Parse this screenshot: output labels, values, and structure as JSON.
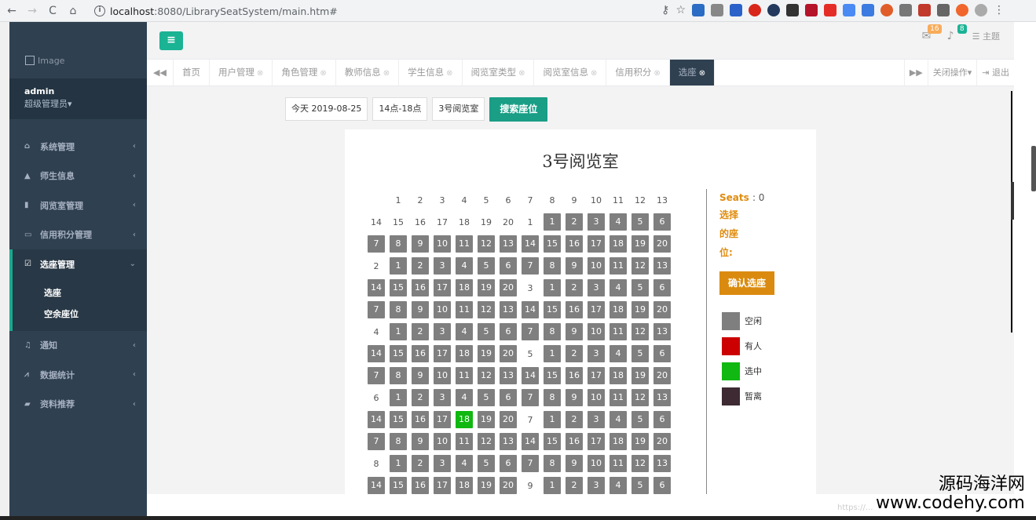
{
  "browser": {
    "back": "←",
    "forward": "→",
    "reload": "C",
    "home": "⌂",
    "url_host": "localhost",
    "url_path": ":8080/LibrarySeatSystem/main.htm#"
  },
  "sidebar": {
    "logo_alt": "Image",
    "user": "admin",
    "role": "超级管理员▾",
    "items": [
      {
        "label": "系统管理",
        "icon": "home-icon"
      },
      {
        "label": "师生信息",
        "icon": "graduation-cap-icon"
      },
      {
        "label": "阅览室管理",
        "icon": "book-icon"
      },
      {
        "label": "信用积分管理",
        "icon": "credit-card-icon"
      },
      {
        "label": "选座管理",
        "icon": "calendar-check-icon"
      },
      {
        "label": "通知",
        "icon": "bell-icon"
      },
      {
        "label": "数据统计",
        "icon": "line-chart-icon"
      },
      {
        "label": "资料推荐",
        "icon": "bookmark-icon"
      }
    ],
    "submenu": [
      "选座",
      "空余座位"
    ]
  },
  "header": {
    "mail_badge": "16",
    "bell_badge": "8",
    "theme_label": "主题"
  },
  "tabs": [
    {
      "label": "首页",
      "closable": false
    },
    {
      "label": "用户管理",
      "closable": true
    },
    {
      "label": "角色管理",
      "closable": true
    },
    {
      "label": "教师信息",
      "closable": true
    },
    {
      "label": "学生信息",
      "closable": true
    },
    {
      "label": "阅览室类型",
      "closable": true
    },
    {
      "label": "阅览室信息",
      "closable": true
    },
    {
      "label": "信用积分",
      "closable": true
    },
    {
      "label": "选座",
      "closable": true,
      "active": true
    }
  ],
  "tab_actions": {
    "close_ops": "关闭操作▾",
    "logout": "退出"
  },
  "filters": {
    "date": "今天 2019-08-25",
    "time": "14点-18点",
    "room": "3号阅览室",
    "search": "搜索座位"
  },
  "seat_map": {
    "title": "3号阅览室",
    "header_numbers": [
      "1",
      "2",
      "3",
      "4",
      "5",
      "6",
      "7",
      "8",
      "9",
      "10",
      "11",
      "12",
      "13"
    ],
    "rows": [
      [
        "14",
        "15",
        "16",
        "17",
        "18",
        "19",
        "20",
        "1",
        "#1",
        "#2",
        "#3",
        "#4",
        "#5",
        "#6"
      ],
      [
        "#7",
        "#8",
        "#9",
        "#10",
        "#11",
        "#12",
        "#13",
        "#14",
        "#15",
        "#16",
        "#17",
        "#18",
        "#19",
        "#20"
      ],
      [
        "2",
        "#1",
        "#2",
        "#3",
        "#4",
        "#5",
        "#6",
        "#7",
        "#8",
        "#9",
        "#10",
        "#11",
        "#12",
        "#13"
      ],
      [
        "#14",
        "#15",
        "#16",
        "#17",
        "#18",
        "#19",
        "#20",
        "3",
        "#1",
        "#2",
        "#3",
        "#4",
        "#5",
        "#6"
      ],
      [
        "#7",
        "#8",
        "#9",
        "#10",
        "#11",
        "#12",
        "#13",
        "#14",
        "#15",
        "#16",
        "#17",
        "#18",
        "#19",
        "#20"
      ],
      [
        "4",
        "#1",
        "#2",
        "#3",
        "#4",
        "#5",
        "#6",
        "#7",
        "#8",
        "#9",
        "#10",
        "#11",
        "#12",
        "#13"
      ],
      [
        "#14",
        "#15",
        "#16",
        "#17",
        "#18",
        "#19",
        "#20",
        "5",
        "#1",
        "#2",
        "#3",
        "#4",
        "#5",
        "#6"
      ],
      [
        "#7",
        "#8",
        "#9",
        "#10",
        "#11",
        "#12",
        "#13",
        "#14",
        "#15",
        "#16",
        "#17",
        "#18",
        "#19",
        "#20"
      ],
      [
        "6",
        "#1",
        "#2",
        "#3",
        "#4",
        "#5",
        "#6",
        "#7",
        "#8",
        "#9",
        "#10",
        "#11",
        "#12",
        "#13"
      ],
      [
        "#14",
        "#15",
        "#16",
        "#17",
        "*18",
        "#19",
        "#20",
        "7",
        "#1",
        "#2",
        "#3",
        "#4",
        "#5",
        "#6"
      ],
      [
        "#7",
        "#8",
        "#9",
        "#10",
        "#11",
        "#12",
        "#13",
        "#14",
        "#15",
        "#16",
        "#17",
        "#18",
        "#19",
        "#20"
      ],
      [
        "8",
        "#1",
        "#2",
        "#3",
        "#4",
        "#5",
        "#6",
        "#7",
        "#8",
        "#9",
        "#10",
        "#11",
        "#12",
        "#13"
      ],
      [
        "#14",
        "#15",
        "#16",
        "#17",
        "#18",
        "#19",
        "#20",
        "9",
        "#1",
        "#2",
        "#3",
        "#4",
        "#5",
        "#6"
      ]
    ]
  },
  "side": {
    "seats_label": "Seats",
    "seats_value": ": 0",
    "selected_label": "选择的座位:",
    "confirm": "确认选座",
    "legend": [
      {
        "label": "空闲",
        "color": "#7f7f7f"
      },
      {
        "label": "有人",
        "color": "#cc0000"
      },
      {
        "label": "选中",
        "color": "#10b811"
      },
      {
        "label": "暂离",
        "color": "#3d2a32"
      }
    ]
  },
  "watermark": {
    "line1": "源码海洋网",
    "line2": "www.codehy.com",
    "faint": "https://..."
  }
}
